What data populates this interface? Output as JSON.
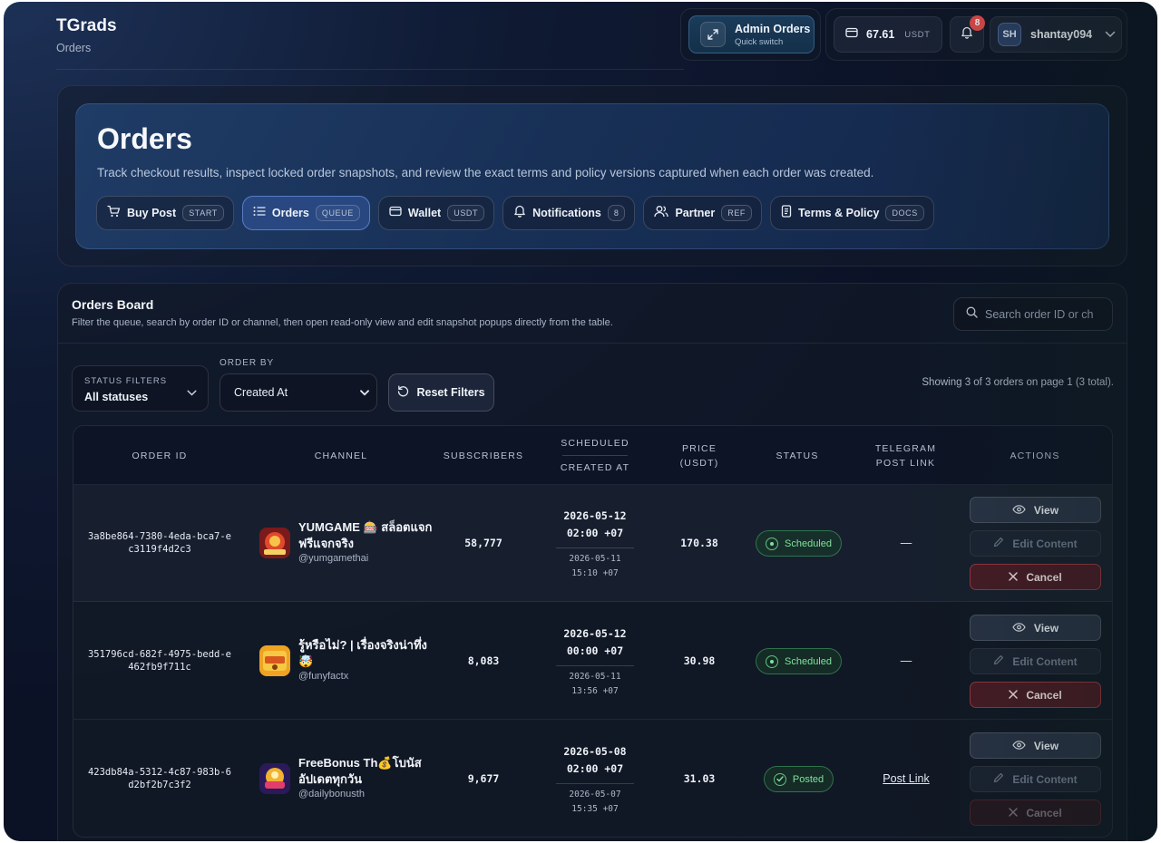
{
  "app": {
    "name": "TGrads",
    "section": "Orders"
  },
  "topbar": {
    "admin": {
      "title": "Admin Orders",
      "subtitle": "Quick switch"
    },
    "wallet": {
      "amount": "67.61",
      "currency": "USDT"
    },
    "notifications": {
      "count": "8"
    },
    "user": {
      "initials": "SH",
      "name": "shantay094"
    }
  },
  "hero": {
    "title": "Orders",
    "description": "Track checkout results, inspect locked order snapshots, and review the exact terms and policy versions captured when each order was created.",
    "nav": [
      {
        "label": "Buy Post",
        "tag": "START",
        "icon": "cart-icon"
      },
      {
        "label": "Orders",
        "tag": "QUEUE",
        "icon": "list-icon",
        "active": true
      },
      {
        "label": "Wallet",
        "tag": "USDT",
        "icon": "wallet-icon"
      },
      {
        "label": "Notifications",
        "tag": "8",
        "icon": "bell-icon"
      },
      {
        "label": "Partner",
        "tag": "REF",
        "icon": "users-icon"
      },
      {
        "label": "Terms & Policy",
        "tag": "DOCS",
        "icon": "document-icon"
      }
    ]
  },
  "board": {
    "title": "Orders Board",
    "description": "Filter the queue, search by order ID or channel, then open read-only view and edit snapshot popups directly from the table.",
    "search_placeholder": "Search order ID or ch",
    "status_filter": {
      "label": "STATUS FILTERS",
      "value": "All statuses"
    },
    "order_by": {
      "label": "ORDER BY",
      "value": "Created At"
    },
    "reset_label": "Reset Filters",
    "showing": "Showing 3 of 3 orders on page 1 (3 total).",
    "columns": {
      "order_id": "ORDER ID",
      "channel": "CHANNEL",
      "subscribers": "SUBSCRIBERS",
      "scheduled": "SCHEDULED",
      "created_at": "CREATED AT",
      "price_1": "PRICE",
      "price_2": "(USDT)",
      "status": "STATUS",
      "telegram_1": "TELEGRAM",
      "telegram_2": "POST LINK",
      "actions": "ACTIONS"
    },
    "rows": [
      {
        "id": "3a8be864-7380-4eda-bca7-ec3119f4d2c3",
        "channel": "YUMGAME 🎰 สล็อตแจกฟรีแจกจริง",
        "handle": "@yumgamethai",
        "subscribers": "58,777",
        "scheduled_date": "2026-05-12",
        "scheduled_time": "02:00 +07",
        "created_date": "2026-05-11",
        "created_time": "15:10 +07",
        "price": "170.38",
        "status": "Scheduled",
        "post_link": "—",
        "actions": {
          "view": "View",
          "edit": "Edit Content",
          "cancel": "Cancel"
        }
      },
      {
        "id": "351796cd-682f-4975-bedd-e462fb9f711c",
        "channel": "รู้หรือไม่? | เรื่องจริงน่าทึ่ง 🤯",
        "handle": "@funyfactx",
        "subscribers": "8,083",
        "scheduled_date": "2026-05-12",
        "scheduled_time": "00:00 +07",
        "created_date": "2026-05-11",
        "created_time": "13:56 +07",
        "price": "30.98",
        "status": "Scheduled",
        "post_link": "—",
        "actions": {
          "view": "View",
          "edit": "Edit Content",
          "cancel": "Cancel"
        }
      },
      {
        "id": "423db84a-5312-4c87-983b-6d2bf2b7c3f2",
        "channel": "FreeBonus Th💰โบนัสอัปเดตทุกวัน",
        "handle": "@dailybonusth",
        "subscribers": "9,677",
        "scheduled_date": "2026-05-08",
        "scheduled_time": "02:00 +07",
        "created_date": "2026-05-07",
        "created_time": "15:35 +07",
        "price": "31.03",
        "status": "Posted",
        "post_link": "Post Link",
        "actions": {
          "view": "View",
          "edit": "Edit Content",
          "cancel": "Cancel"
        }
      }
    ]
  },
  "colors": {
    "accent": "#2f5aa8",
    "success": "#7ee39a",
    "danger": "#e34b4b"
  }
}
